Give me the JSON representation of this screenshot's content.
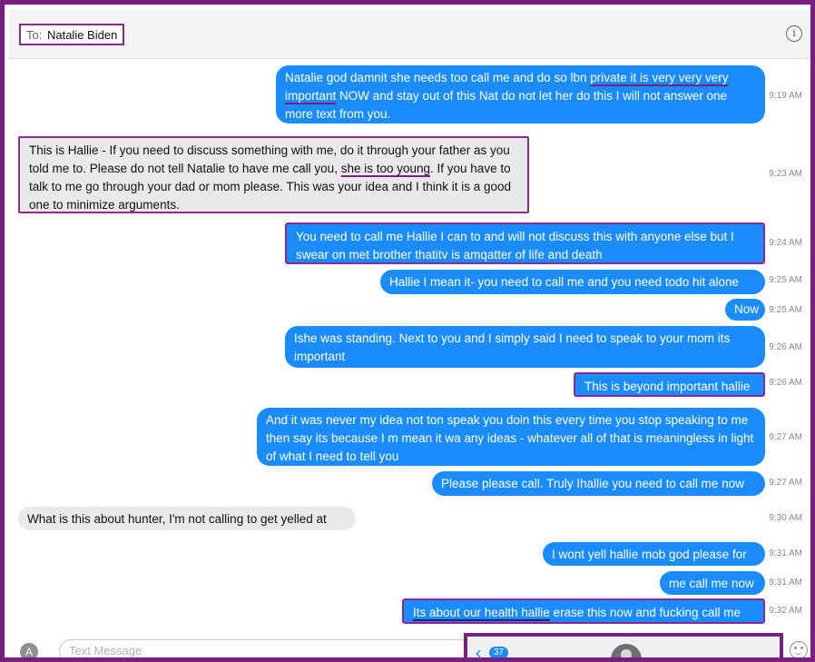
{
  "header": {
    "to_label": "To:",
    "recipient": "Natalie Biden",
    "info_icon": "info-icon"
  },
  "messages": [
    {
      "direction": "outgoing",
      "text": "Natalie god damnit she needs too call me and do so lbn private it is very very very important NOW and stay out of this Nat do not let her do this I will not answer one more text from you.",
      "time": "9:19 AM"
    },
    {
      "direction": "incoming",
      "text": "This is Hallie - If you need to discuss something with me, do it through your father as you told me to. Please do not tell Natalie to have me call you, she is too young. If you have to talk to me go through your dad or mom please. This was your idea and I think it is a good one to minimize arguments.",
      "time": "9:23 AM"
    },
    {
      "direction": "outgoing",
      "text": "You need to call me Hallie I can to and will not discuss this with anyone else but I swear on met brother thatitv is amqatter of life and death",
      "time": "9:24 AM"
    },
    {
      "direction": "outgoing",
      "text": "Hallie I mean it- you need to call me and you need todo hit alone",
      "time": "9:25 AM"
    },
    {
      "direction": "outgoing",
      "text": "Now",
      "time": "9:25 AM"
    },
    {
      "direction": "outgoing",
      "text": "Ishe was standing. Next to you and I simply said I need to speak to your mom its important",
      "time": "9:26 AM"
    },
    {
      "direction": "outgoing",
      "text": "This is beyond important hallie",
      "time": "9:26 AM"
    },
    {
      "direction": "outgoing",
      "text": "And it was never my idea not ton speak you doin this every time you stop speaking to me then say its because I m mean it wa any ideas - whatever all of that is meaningless in light of what I need to tell you",
      "time": "9:27 AM"
    },
    {
      "direction": "outgoing",
      "text": "Please please call. Truly Ihallie you need to call me now",
      "time": "9:27 AM"
    },
    {
      "direction": "incoming",
      "text": "What is this about hunter, I'm not calling to get yelled at",
      "time": "9:30 AM"
    },
    {
      "direction": "outgoing",
      "text": "I wont yell hallie mob god please for",
      "time": "9:31 AM"
    },
    {
      "direction": "outgoing",
      "text": "me call me now",
      "time": "9:31 AM"
    },
    {
      "direction": "outgoing",
      "text": "Its about our health hallie erase this now and fucking call me",
      "time": "9:32 AM"
    }
  ],
  "m0": {
    "a": "Natalie god damnit she needs too call me and do so lbn ",
    "b": "private it is very very very",
    "c": " ",
    "d": "important",
    "e": " NOW and stay out of this Nat do not let her do this I will not answer one more text from you."
  },
  "m1": {
    "a": "This is Hallie - If you need to discuss something with me, do it through your father as you told me to. Please do not tell Natalie to have me call you, ",
    "b": "she is too young",
    "c": ". If you have to talk to me go through your dad or mom please. This was your idea and I think it is a good one to minimize arguments."
  },
  "m12": {
    "a": "Its about our health hallie",
    "b": " erase this now and fucking call me"
  },
  "composer": {
    "placeholder": "Text Message",
    "apps_icon": "app-store-icon",
    "emoji_icon": "emoji-icon"
  },
  "overlay": {
    "back_icon": "chevron-left-icon",
    "badge": "37",
    "avatar_icon": "contact-avatar-icon"
  },
  "colors": {
    "outgoing": "#1a8cff",
    "incoming": "#e9e9eb",
    "annotation": "#7a1f7f"
  }
}
